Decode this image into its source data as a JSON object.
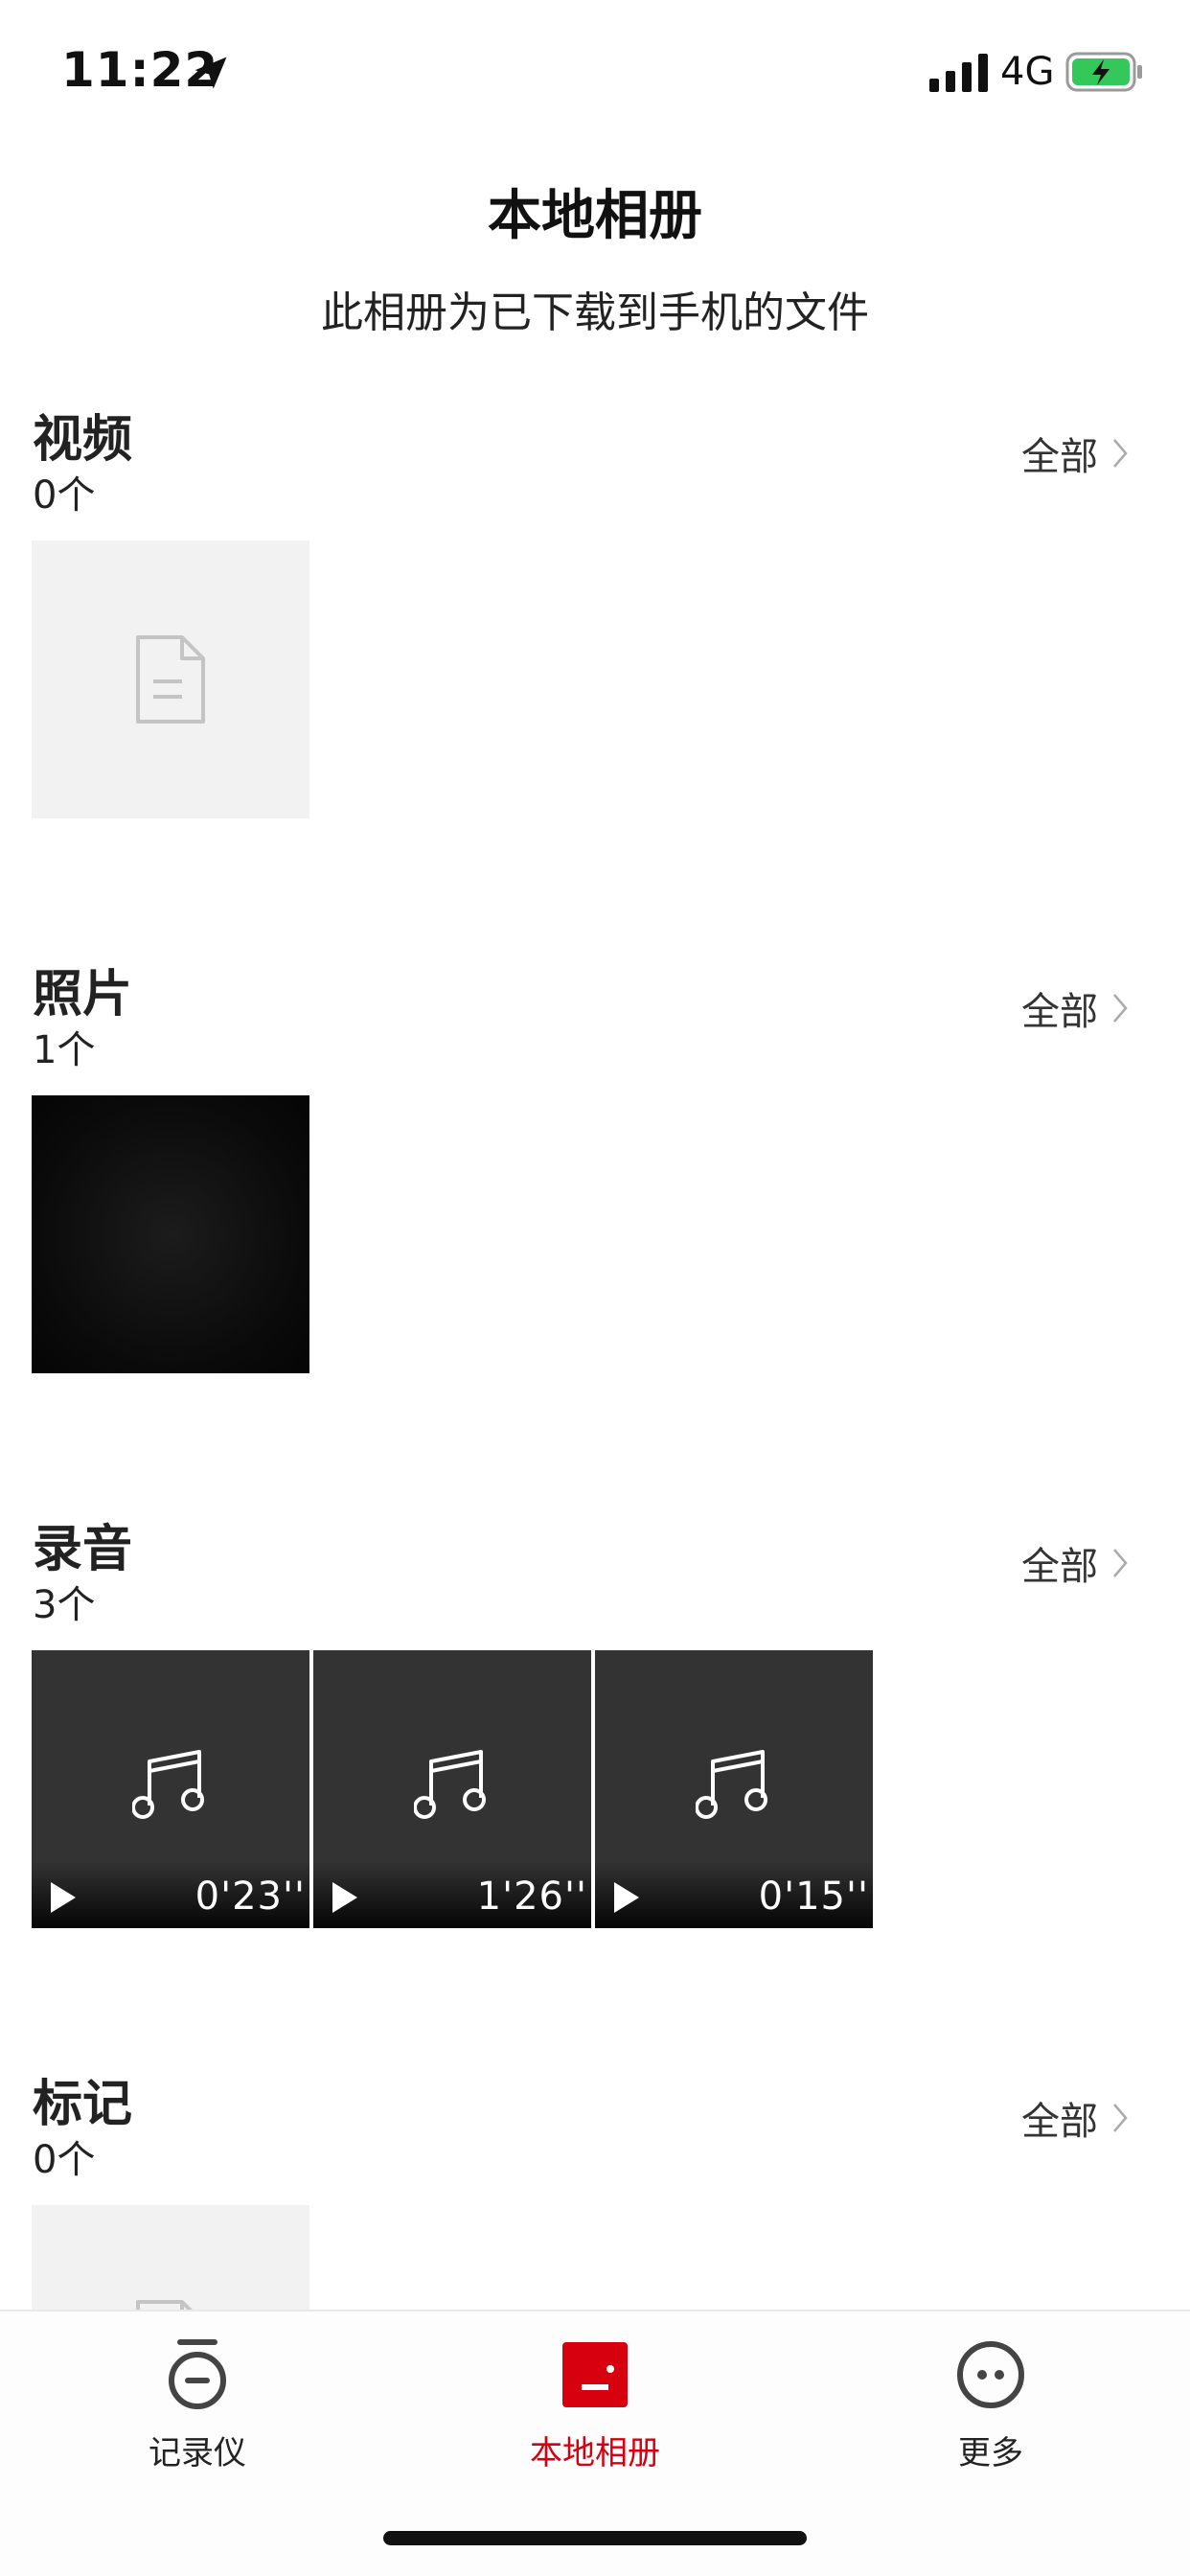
{
  "status_bar": {
    "time": "11:22",
    "network": "4G",
    "icons": [
      "location-arrow-icon",
      "signal-icon",
      "battery-charging-icon"
    ]
  },
  "header": {
    "title": "本地相册",
    "subtitle": "此相册为已下载到手机的文件"
  },
  "sections": {
    "video": {
      "title": "视频",
      "count": "0个",
      "see_all": "全部"
    },
    "photo": {
      "title": "照片",
      "count": "1个",
      "see_all": "全部"
    },
    "audio": {
      "title": "录音",
      "count": "3个",
      "see_all": "全部",
      "items": [
        {
          "duration": "0'23''"
        },
        {
          "duration": "1'26''"
        },
        {
          "duration": "0'15''"
        }
      ]
    },
    "marks": {
      "title": "标记",
      "count": "0个",
      "see_all": "全部"
    }
  },
  "tab_bar": {
    "tabs": [
      {
        "label": "记录仪",
        "icon": "recorder-icon",
        "active": false
      },
      {
        "label": "本地相册",
        "icon": "album-icon",
        "active": true
      },
      {
        "label": "更多",
        "icon": "more-icon",
        "active": false
      }
    ]
  },
  "colors": {
    "accent": "#d7000f",
    "placeholder_bg": "#f2f2f2",
    "audio_bg": "#333333"
  }
}
